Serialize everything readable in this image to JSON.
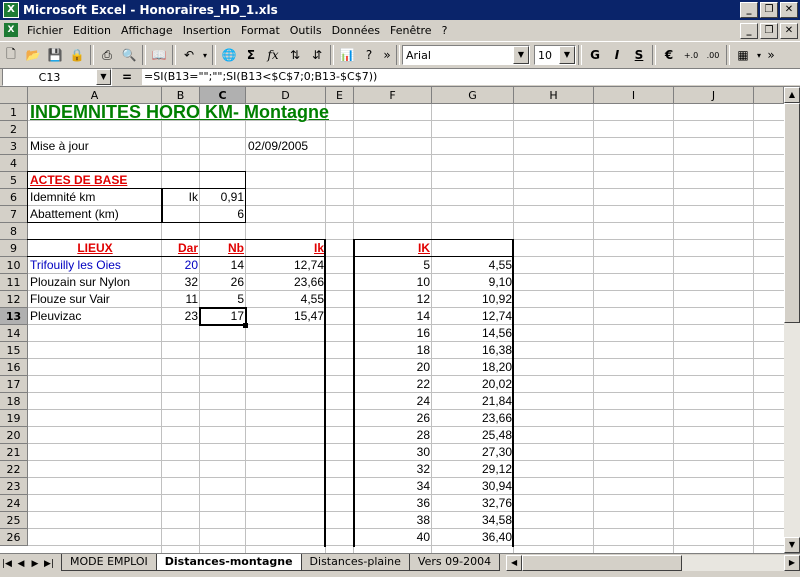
{
  "window": {
    "title": "Microsoft Excel - Honoraires_HD_1.xls"
  },
  "menu": [
    "Fichier",
    "Edition",
    "Affichage",
    "Insertion",
    "Format",
    "Outils",
    "Données",
    "Fenêtre",
    "?"
  ],
  "toolbar": {
    "font": "Arial",
    "size": "10",
    "bold": "G",
    "italic": "I",
    "underline": "S",
    "currency": "€"
  },
  "formula_bar": {
    "name_box": "C13",
    "equals": "=",
    "formula": "=SI(B13=\"\";\"\";SI(B13<$C$7;0;B13-$C$7))"
  },
  "columns": [
    "A",
    "B",
    "C",
    "D",
    "E",
    "F",
    "G",
    "H",
    "I",
    "J"
  ],
  "rows": [
    "1",
    "2",
    "3",
    "4",
    "5",
    "6",
    "7",
    "8",
    "9",
    "10",
    "11",
    "12",
    "13",
    "14",
    "15",
    "16",
    "17",
    "18",
    "19",
    "20",
    "21",
    "22",
    "23",
    "24",
    "25",
    "26"
  ],
  "sheet": {
    "title": "INDEMNITES HORO KM- Montagne",
    "update_label": "Mise à jour",
    "update_date": "02/09/2005",
    "base_header": "ACTES DE BASE",
    "indemnite_label": "Idemnité km",
    "indemnite_unit": "Ik",
    "indemnite_value": "0,91",
    "abattement_label": "Abattement (km)",
    "abattement_value": "6",
    "hdr_lieux": "LIEUX",
    "hdr_dar": "Dar",
    "hdr_nb": "Nb",
    "hdr_ik": "Ik",
    "hdr_ik2": "IK",
    "places": [
      {
        "name": "Trifouilly les Oies",
        "dar": "20",
        "nb": "14",
        "ik": "12,74"
      },
      {
        "name": "Plouzain sur Nylon",
        "dar": "32",
        "nb": "26",
        "ik": "23,66"
      },
      {
        "name": "Flouze sur Vair",
        "dar": "11",
        "nb": "5",
        "ik": "4,55"
      },
      {
        "name": "Pleuvizac",
        "dar": "23",
        "nb": "17",
        "ik": "15,47"
      }
    ],
    "ik_table": [
      [
        "5",
        "4,55"
      ],
      [
        "10",
        "9,10"
      ],
      [
        "12",
        "10,92"
      ],
      [
        "14",
        "12,74"
      ],
      [
        "16",
        "14,56"
      ],
      [
        "18",
        "16,38"
      ],
      [
        "20",
        "18,20"
      ],
      [
        "22",
        "20,02"
      ],
      [
        "24",
        "21,84"
      ],
      [
        "26",
        "23,66"
      ],
      [
        "28",
        "25,48"
      ],
      [
        "30",
        "27,30"
      ],
      [
        "32",
        "29,12"
      ],
      [
        "34",
        "30,94"
      ],
      [
        "36",
        "32,76"
      ],
      [
        "38",
        "34,58"
      ],
      [
        "40",
        "36,40"
      ]
    ]
  },
  "tabs": [
    "MODE EMPLOI",
    "Distances-montagne",
    "Distances-plaine",
    "Vers 09-2004"
  ],
  "active_tab": "Distances-montagne"
}
